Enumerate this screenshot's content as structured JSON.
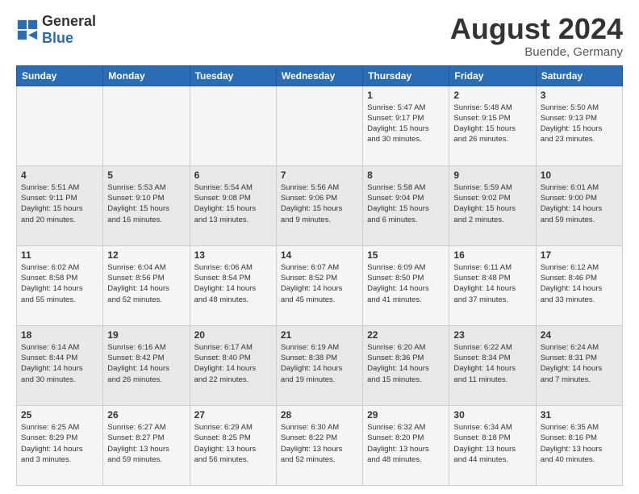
{
  "logo": {
    "general": "General",
    "blue": "Blue"
  },
  "title": "August 2024",
  "location": "Buende, Germany",
  "days_of_week": [
    "Sunday",
    "Monday",
    "Tuesday",
    "Wednesday",
    "Thursday",
    "Friday",
    "Saturday"
  ],
  "weeks": [
    [
      {
        "day": "",
        "info": ""
      },
      {
        "day": "",
        "info": ""
      },
      {
        "day": "",
        "info": ""
      },
      {
        "day": "",
        "info": ""
      },
      {
        "day": "1",
        "info": "Sunrise: 5:47 AM\nSunset: 9:17 PM\nDaylight: 15 hours\nand 30 minutes."
      },
      {
        "day": "2",
        "info": "Sunrise: 5:48 AM\nSunset: 9:15 PM\nDaylight: 15 hours\nand 26 minutes."
      },
      {
        "day": "3",
        "info": "Sunrise: 5:50 AM\nSunset: 9:13 PM\nDaylight: 15 hours\nand 23 minutes."
      }
    ],
    [
      {
        "day": "4",
        "info": "Sunrise: 5:51 AM\nSunset: 9:11 PM\nDaylight: 15 hours\nand 20 minutes."
      },
      {
        "day": "5",
        "info": "Sunrise: 5:53 AM\nSunset: 9:10 PM\nDaylight: 15 hours\nand 16 minutes."
      },
      {
        "day": "6",
        "info": "Sunrise: 5:54 AM\nSunset: 9:08 PM\nDaylight: 15 hours\nand 13 minutes."
      },
      {
        "day": "7",
        "info": "Sunrise: 5:56 AM\nSunset: 9:06 PM\nDaylight: 15 hours\nand 9 minutes."
      },
      {
        "day": "8",
        "info": "Sunrise: 5:58 AM\nSunset: 9:04 PM\nDaylight: 15 hours\nand 6 minutes."
      },
      {
        "day": "9",
        "info": "Sunrise: 5:59 AM\nSunset: 9:02 PM\nDaylight: 15 hours\nand 2 minutes."
      },
      {
        "day": "10",
        "info": "Sunrise: 6:01 AM\nSunset: 9:00 PM\nDaylight: 14 hours\nand 59 minutes."
      }
    ],
    [
      {
        "day": "11",
        "info": "Sunrise: 6:02 AM\nSunset: 8:58 PM\nDaylight: 14 hours\nand 55 minutes."
      },
      {
        "day": "12",
        "info": "Sunrise: 6:04 AM\nSunset: 8:56 PM\nDaylight: 14 hours\nand 52 minutes."
      },
      {
        "day": "13",
        "info": "Sunrise: 6:06 AM\nSunset: 8:54 PM\nDaylight: 14 hours\nand 48 minutes."
      },
      {
        "day": "14",
        "info": "Sunrise: 6:07 AM\nSunset: 8:52 PM\nDaylight: 14 hours\nand 45 minutes."
      },
      {
        "day": "15",
        "info": "Sunrise: 6:09 AM\nSunset: 8:50 PM\nDaylight: 14 hours\nand 41 minutes."
      },
      {
        "day": "16",
        "info": "Sunrise: 6:11 AM\nSunset: 8:48 PM\nDaylight: 14 hours\nand 37 minutes."
      },
      {
        "day": "17",
        "info": "Sunrise: 6:12 AM\nSunset: 8:46 PM\nDaylight: 14 hours\nand 33 minutes."
      }
    ],
    [
      {
        "day": "18",
        "info": "Sunrise: 6:14 AM\nSunset: 8:44 PM\nDaylight: 14 hours\nand 30 minutes."
      },
      {
        "day": "19",
        "info": "Sunrise: 6:16 AM\nSunset: 8:42 PM\nDaylight: 14 hours\nand 26 minutes."
      },
      {
        "day": "20",
        "info": "Sunrise: 6:17 AM\nSunset: 8:40 PM\nDaylight: 14 hours\nand 22 minutes."
      },
      {
        "day": "21",
        "info": "Sunrise: 6:19 AM\nSunset: 8:38 PM\nDaylight: 14 hours\nand 19 minutes."
      },
      {
        "day": "22",
        "info": "Sunrise: 6:20 AM\nSunset: 8:36 PM\nDaylight: 14 hours\nand 15 minutes."
      },
      {
        "day": "23",
        "info": "Sunrise: 6:22 AM\nSunset: 8:34 PM\nDaylight: 14 hours\nand 11 minutes."
      },
      {
        "day": "24",
        "info": "Sunrise: 6:24 AM\nSunset: 8:31 PM\nDaylight: 14 hours\nand 7 minutes."
      }
    ],
    [
      {
        "day": "25",
        "info": "Sunrise: 6:25 AM\nSunset: 8:29 PM\nDaylight: 14 hours\nand 3 minutes."
      },
      {
        "day": "26",
        "info": "Sunrise: 6:27 AM\nSunset: 8:27 PM\nDaylight: 13 hours\nand 59 minutes."
      },
      {
        "day": "27",
        "info": "Sunrise: 6:29 AM\nSunset: 8:25 PM\nDaylight: 13 hours\nand 56 minutes."
      },
      {
        "day": "28",
        "info": "Sunrise: 6:30 AM\nSunset: 8:22 PM\nDaylight: 13 hours\nand 52 minutes."
      },
      {
        "day": "29",
        "info": "Sunrise: 6:32 AM\nSunset: 8:20 PM\nDaylight: 13 hours\nand 48 minutes."
      },
      {
        "day": "30",
        "info": "Sunrise: 6:34 AM\nSunset: 8:18 PM\nDaylight: 13 hours\nand 44 minutes."
      },
      {
        "day": "31",
        "info": "Sunrise: 6:35 AM\nSunset: 8:16 PM\nDaylight: 13 hours\nand 40 minutes."
      }
    ]
  ]
}
